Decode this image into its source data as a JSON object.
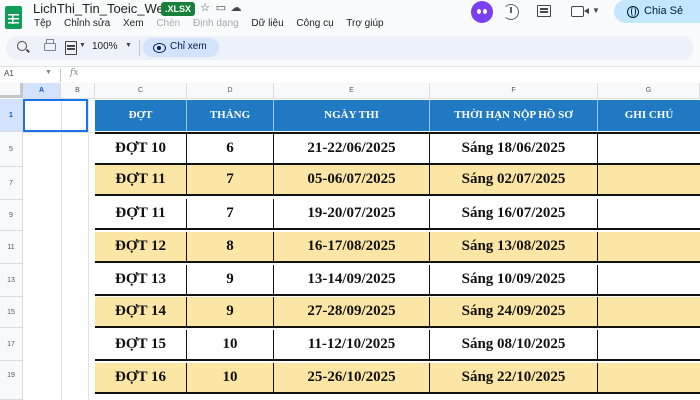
{
  "app": {
    "doc_title": "LichThi_Tin_Toeic_Web",
    "file_badge": ".XLSX",
    "menus": [
      "Tệp",
      "Chỉnh sửa",
      "Xem",
      "Chèn",
      "Định dạng",
      "Dữ liệu",
      "Công cụ",
      "Trợ giúp"
    ],
    "disabled_menus": [
      "Chèn",
      "Định dạng"
    ],
    "share_label": "Chia Sẻ"
  },
  "toolbar": {
    "zoom": "100%",
    "view_only_label": "Chỉ xem"
  },
  "formula_bar": {
    "name_box": "A1",
    "fx": "fx"
  },
  "grid": {
    "columns": [
      "A",
      "B",
      "C",
      "D",
      "E",
      "F",
      "G"
    ],
    "row_numbers": [
      "1",
      "5",
      "7",
      "9",
      "11",
      "13",
      "15",
      "17",
      "19"
    ]
  },
  "table": {
    "headers": [
      "ĐỢT",
      "THÁNG",
      "NGÀY THI",
      "THỜI HẠN NỘP HỒ SƠ",
      "GHI CHÚ"
    ],
    "rows": [
      {
        "dot": "ĐỢT 10",
        "thang": "6",
        "ngay_thi": "21-22/06/2025",
        "han_nop": "Sáng 18/06/2025",
        "ghi_chu": "",
        "style": "white"
      },
      {
        "dot": "ĐỢT 11",
        "thang": "7",
        "ngay_thi": "05-06/07/2025",
        "han_nop": "Sáng 02/07/2025",
        "ghi_chu": "",
        "style": "yellow"
      },
      {
        "dot": "ĐỢT 11",
        "thang": "7",
        "ngay_thi": "19-20/07/2025",
        "han_nop": "Sáng 16/07/2025",
        "ghi_chu": "",
        "style": "white"
      },
      {
        "dot": "ĐỢT 12",
        "thang": "8",
        "ngay_thi": "16-17/08/2025",
        "han_nop": "Sáng 13/08/2025",
        "ghi_chu": "",
        "style": "yellow"
      },
      {
        "dot": "ĐỢT 13",
        "thang": "9",
        "ngay_thi": "13-14/09/2025",
        "han_nop": "Sáng 10/09/2025",
        "ghi_chu": "",
        "style": "white"
      },
      {
        "dot": "ĐỢT 14",
        "thang": "9",
        "ngay_thi": "27-28/09/2025",
        "han_nop": "Sáng 24/09/2025",
        "ghi_chu": "",
        "style": "yellow"
      },
      {
        "dot": "ĐỢT 15",
        "thang": "10",
        "ngay_thi": "11-12/10/2025",
        "han_nop": "Sáng 08/10/2025",
        "ghi_chu": "",
        "style": "white"
      },
      {
        "dot": "ĐỢT 16",
        "thang": "10",
        "ngay_thi": "25-26/10/2025",
        "han_nop": "Sáng 22/10/2025",
        "ghi_chu": "",
        "style": "yellow"
      }
    ]
  },
  "colors": {
    "header_blue": "#1f7ac3",
    "row_yellow": "#fbe6a6",
    "share_bg": "#c2e7ff",
    "badge_green": "#188038"
  }
}
